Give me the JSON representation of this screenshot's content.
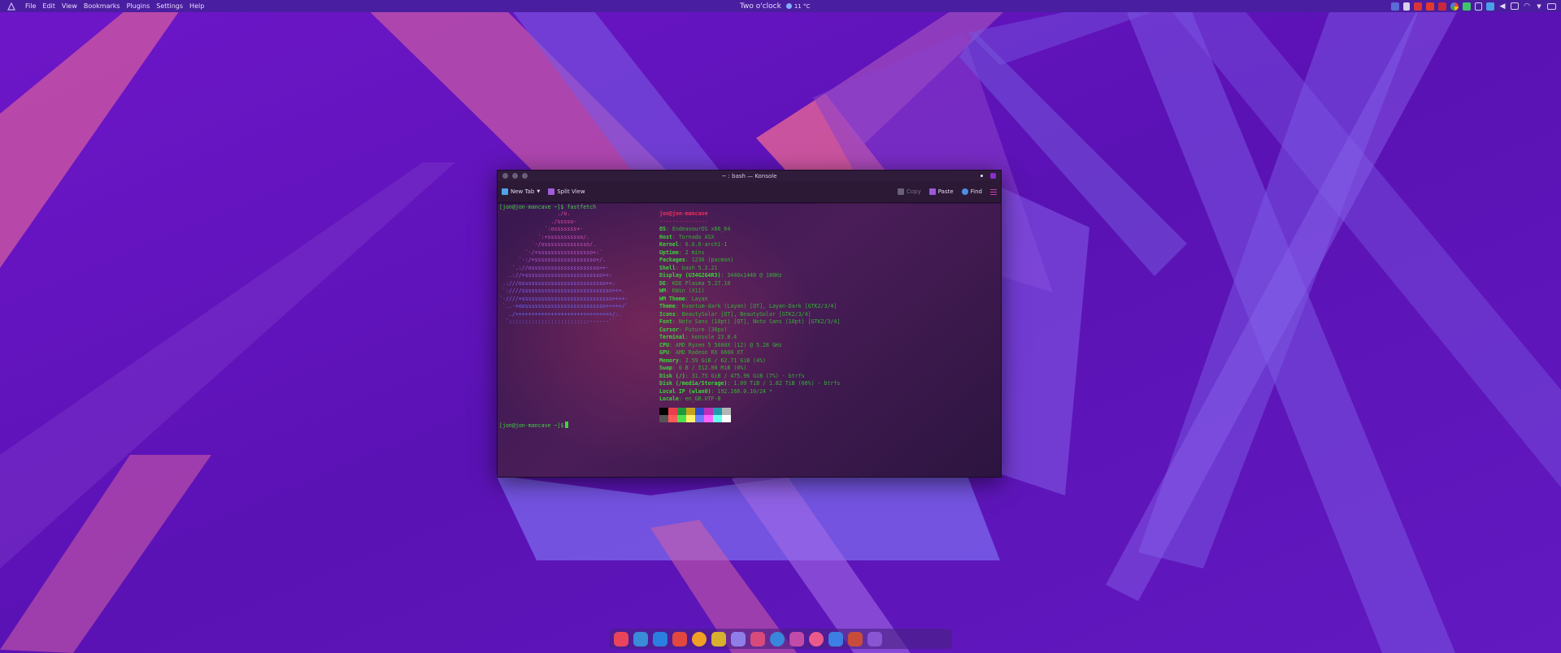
{
  "menubar": {
    "items": [
      "File",
      "Edit",
      "View",
      "Bookmarks",
      "Plugins",
      "Settings",
      "Help"
    ],
    "clock": "Two o'clock",
    "weather": "11 °C",
    "tray_icons": [
      "display-icon",
      "bell-icon",
      "red-app-icon",
      "red-app-icon",
      "red-app-icon",
      "google-icon",
      "green-app-icon",
      "clipboard-icon",
      "vpn-icon",
      "volume-icon",
      "network-icon",
      "wifi-icon",
      "chevron-down-icon",
      "battery-icon"
    ]
  },
  "window": {
    "title": "~ : bash — Konsole",
    "toolbar": {
      "new_tab": "New Tab",
      "split_view": "Split View",
      "copy": "Copy",
      "paste": "Paste",
      "find": "Find"
    }
  },
  "terminal": {
    "prompt": "[jon@jon-mancave ~]$",
    "command": "fastfetch",
    "user_host": "jon@jon-mancave",
    "separator": "---------------",
    "logo_lines": [
      "                  ./o.",
      "                ./sssso-",
      "              `:osssssss+-",
      "            `:+sssssssssso/.",
      "          `-/ossssssssssssso/.",
      "        `-/+sssssssssssssssso+:`",
      "      `-:/+sssssssssssssssssso+/.",
      "    `.://osssssssssssssssssssso++-",
      "   .://+ssssssssssssssssssssssso++:",
      " .:///ossssssssssssssssssssssssso++:",
      " `:////ssssssssssssssssssssssssssso+++.",
      "`-////+ssssssssssssssssssssssssssso++++-",
      " `..-+oosssssssssssssssssssssssso+++++/`",
      "   ./++++++++++++++++++++++++++++++/:.",
      "  `:::::::::::::::::::::::::------``"
    ],
    "info": [
      {
        "key": "OS",
        "value": ": EndeavourOS x86_64"
      },
      {
        "key": "Host",
        "value": ": Tornado ASX"
      },
      {
        "key": "Kernel",
        "value": ": 6.6.6-arch1-1"
      },
      {
        "key": "Uptime",
        "value": ": 2 mins"
      },
      {
        "key": "Packages",
        "value": ": 1236 (pacman)"
      },
      {
        "key": "Shell",
        "value": ": bash 5.2.21"
      },
      {
        "key": "Display (U34G2G4R3)",
        "value": ": 3440x1440 @ 180Hz"
      },
      {
        "key": "DE",
        "value": ": KDE Plasma 5.27.10"
      },
      {
        "key": "WM",
        "value": ": KWin (X11)"
      },
      {
        "key": "WM Theme",
        "value": ": Layan"
      },
      {
        "key": "Theme",
        "value": ": Kvantum-dark (Layan) [QT], Layan-Dark [GTK2/3/4]"
      },
      {
        "key": "Icons",
        "value": ": BeautySolar [QT], BeautySolar [GTK2/3/4]"
      },
      {
        "key": "Font",
        "value": ": Noto Sans (10pt) [QT], Noto Sans (10pt) [GTK2/3/4]"
      },
      {
        "key": "Cursor",
        "value": ": Future (30px)"
      },
      {
        "key": "Terminal",
        "value": ": konsole 23.8.4"
      },
      {
        "key": "CPU",
        "value": ": AMD Ryzen 5 5600X (12) @ 5.28 GHz"
      },
      {
        "key": "GPU",
        "value": ": AMD Radeon RX 6600 XT"
      },
      {
        "key": "Memory",
        "value": ": 2.59 GiB / 62.71 GiB (4%)"
      },
      {
        "key": "Swap",
        "value": ": 0 B / 512.00 MiB (0%)"
      },
      {
        "key": "Disk (/)",
        "value": ": 31.75 GiB / 475.96 GiB (7%) - btrfs"
      },
      {
        "key": "Disk (/media/Storage)",
        "value": ": 1.09 TiB / 1.82 TiB (60%) - btrfs"
      },
      {
        "key": "Local IP (wlan0)",
        "value": ": 192.168.0.10/24 *"
      },
      {
        "key": "Locale",
        "value": ": en_GB.UTF-8"
      }
    ],
    "palette": [
      "#000000",
      "#ea3d4d",
      "#1d9b3c",
      "#c9a21c",
      "#2d4fcf",
      "#c02fb8",
      "#1f9cab",
      "#b4b4b4",
      "#555555",
      "#ff5a5a",
      "#4fe04f",
      "#fff26a",
      "#6a7dff",
      "#ff62ff",
      "#62fff0",
      "#ffffff"
    ]
  },
  "dock": {
    "apps": [
      "#e8455c",
      "#3a8bd8",
      "#2b7fe0",
      "#e2473f",
      "#f0a024",
      "#d8b030",
      "#8f7ee8",
      "#d64a7c",
      "#3a86dc",
      "#c24aa8",
      "#ec5a8c",
      "#3c7ee4",
      "#c84c3c",
      "#8a55d2"
    ]
  }
}
